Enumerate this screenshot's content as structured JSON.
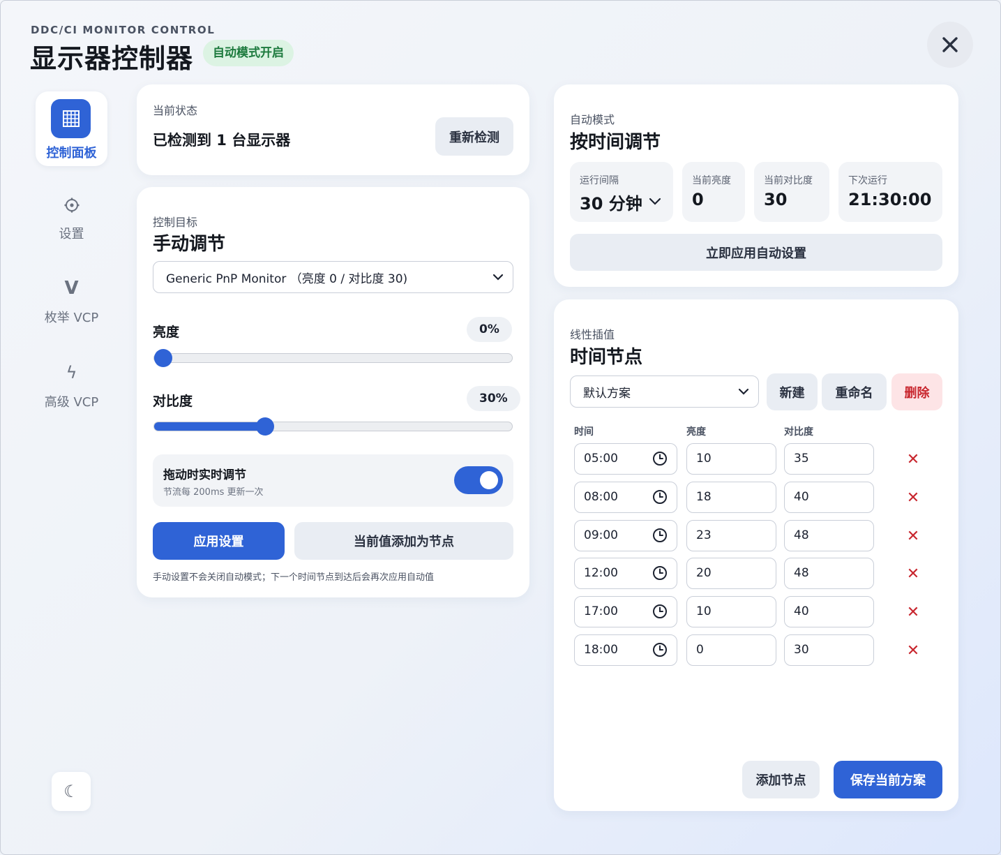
{
  "header": {
    "subtitle": "DDC/CI MONITOR CONTROL",
    "title": "显示器控制器",
    "auto_badge": "自动模式开启"
  },
  "sidebar": {
    "items": [
      {
        "label": "控制面板",
        "icon": "grid-icon",
        "active": true
      },
      {
        "label": "设置",
        "icon": "gear-icon"
      },
      {
        "label": "枚举 VCP",
        "icon": "v-icon",
        "glyph": "V"
      },
      {
        "label": "高级 VCP",
        "icon": "bolt-icon",
        "glyph": "ϟ"
      }
    ],
    "theme_glyph": "☾"
  },
  "status_card": {
    "eyebrow": "当前状态",
    "status_text": "已检测到 1 台显示器",
    "redetect_label": "重新检测"
  },
  "manual_card": {
    "eyebrow": "控制目标",
    "title": "手动调节",
    "monitor_select": "Generic PnP Monitor （亮度 0 / 对比度 30)",
    "brightness_label": "亮度",
    "brightness_value": "0%",
    "brightness_level": 0,
    "contrast_label": "对比度",
    "contrast_value": "30%",
    "contrast_level": 30,
    "realtime_title": "拖动时实时调节",
    "realtime_desc": "节流每 200ms 更新一次",
    "realtime_on": true,
    "apply_label": "应用设置",
    "add_node_label": "当前值添加为节点",
    "note": "手动设置不会关闭自动模式；下一个时间节点到达后会再次应用自动值"
  },
  "auto_card": {
    "eyebrow": "自动模式",
    "title": "按时间调节",
    "interval_label": "运行间隔",
    "interval_value": "30 分钟",
    "brightness_label": "当前亮度",
    "brightness_value": "0",
    "contrast_label": "当前对比度",
    "contrast_value": "30",
    "next_label": "下次运行",
    "next_value": "21:30:00",
    "apply_now_label": "立即应用自动设置"
  },
  "nodes_card": {
    "eyebrow": "线性插值",
    "title": "时间节点",
    "scheme_select": "默认方案",
    "new_label": "新建",
    "rename_label": "重命名",
    "delete_label": "删除",
    "col_time": "时间",
    "col_brightness": "亮度",
    "col_contrast": "对比度",
    "rows": [
      {
        "time": "05:00",
        "brightness": "10",
        "contrast": "35"
      },
      {
        "time": "08:00",
        "brightness": "18",
        "contrast": "40"
      },
      {
        "time": "09:00",
        "brightness": "23",
        "contrast": "48"
      },
      {
        "time": "12:00",
        "brightness": "20",
        "contrast": "48"
      },
      {
        "time": "17:00",
        "brightness": "10",
        "contrast": "40"
      },
      {
        "time": "18:00",
        "brightness": "0",
        "contrast": "30"
      }
    ],
    "delete_row_glyph": "✕",
    "add_node_label": "添加节点",
    "save_label": "保存当前方案"
  },
  "colors": {
    "accent": "#2f63d6",
    "success_bg": "#dcf3e3",
    "success_text": "#1c7a3d",
    "danger_bg": "#fde4e6",
    "danger_text": "#c8262e"
  }
}
